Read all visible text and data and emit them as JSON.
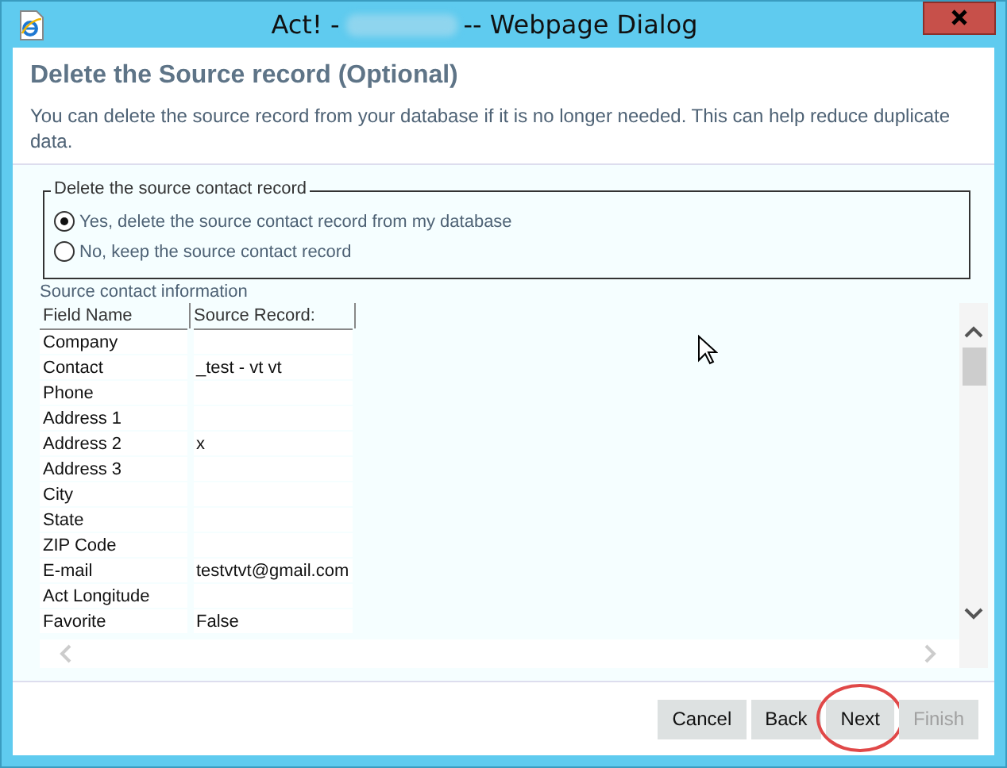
{
  "window": {
    "title_prefix": "Act! -",
    "title_suffix": "-- Webpage Dialog"
  },
  "header": {
    "title": "Delete the Source record (Optional)",
    "description": "You can delete the source record from your database if it is no longer needed. This can help reduce duplicate data."
  },
  "delete_group": {
    "legend": "Delete the source contact record",
    "options": [
      {
        "label": "Yes, delete the source contact record from my database",
        "selected": true
      },
      {
        "label": "No, keep the source contact record",
        "selected": false
      }
    ]
  },
  "source_info": {
    "caption": "Source contact information",
    "columns": [
      "Field Name",
      "Source Record:"
    ],
    "rows": [
      [
        "Company",
        ""
      ],
      [
        "Contact",
        "_test - vt vt"
      ],
      [
        "Phone",
        ""
      ],
      [
        "Address 1",
        ""
      ],
      [
        "Address 2",
        "x"
      ],
      [
        "Address 3",
        ""
      ],
      [
        "City",
        ""
      ],
      [
        "State",
        ""
      ],
      [
        "ZIP Code",
        ""
      ],
      [
        "E-mail",
        "testvtvt@gmail.com"
      ],
      [
        "Act Longitude",
        ""
      ],
      [
        "Favorite",
        "False"
      ]
    ]
  },
  "buttons": [
    {
      "label": "Cancel",
      "disabled": false,
      "highlighted": false
    },
    {
      "label": "Back",
      "disabled": false,
      "highlighted": false
    },
    {
      "label": "Next",
      "disabled": false,
      "highlighted": true
    },
    {
      "label": "Finish",
      "disabled": true,
      "highlighted": false
    }
  ]
}
